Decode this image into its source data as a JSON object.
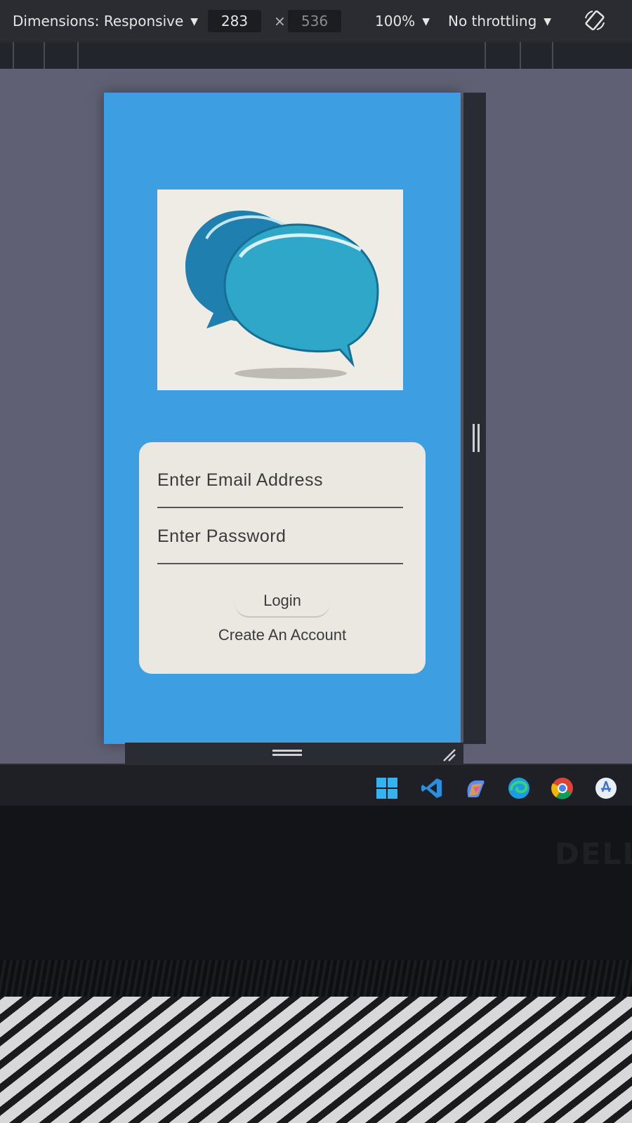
{
  "devtools": {
    "dimensions_label": "Dimensions: Responsive",
    "width_value": "283",
    "times_sign": "×",
    "height_value": "536",
    "zoom_label": "100%",
    "throttling_label": "No throttling"
  },
  "app": {
    "email_placeholder": "Enter Email Address",
    "password_placeholder": "Enter Password",
    "login_label": "Login",
    "create_account_label": "Create An Account"
  },
  "taskbar": {
    "icons": [
      "windows-start-icon",
      "vscode-icon",
      "copilot-icon",
      "edge-icon",
      "chrome-icon",
      "app-store-icon"
    ]
  },
  "laptop": {
    "brand_label": "DELL"
  },
  "colors": {
    "app_background": "#3d9ee2",
    "card_background": "#eae8e0",
    "bubble_dark": "#1f7fae",
    "bubble_light": "#2fa7c8"
  }
}
